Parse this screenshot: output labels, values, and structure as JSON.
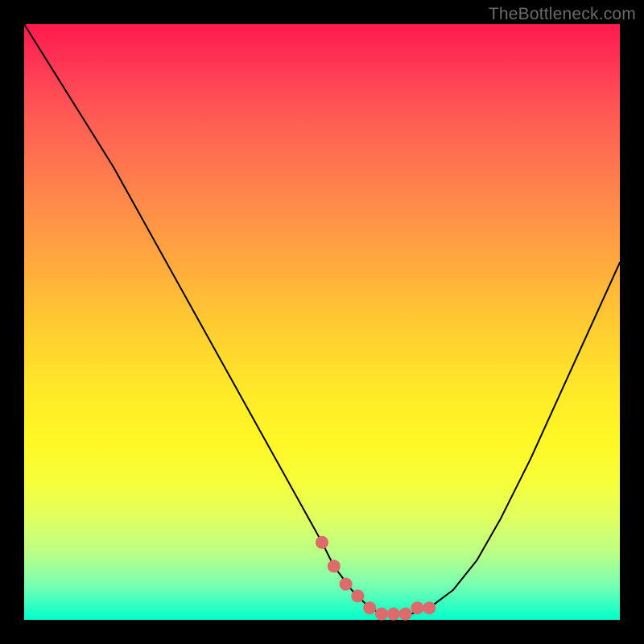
{
  "watermark": "TheBottleneck.com",
  "chart_data": {
    "type": "line",
    "title": "",
    "xlabel": "",
    "ylabel": "",
    "xlim": [
      0,
      100
    ],
    "ylim": [
      0,
      100
    ],
    "series": [
      {
        "name": "curve",
        "x": [
          0,
          5,
          10,
          15,
          20,
          25,
          30,
          35,
          40,
          45,
          50,
          52,
          55,
          58,
          60,
          62,
          65,
          68,
          72,
          76,
          80,
          85,
          90,
          95,
          100
        ],
        "values": [
          100,
          92,
          84,
          76,
          67,
          58,
          49,
          40,
          31,
          22,
          13,
          9,
          5,
          2,
          1,
          1,
          1,
          2,
          5,
          10,
          17,
          27,
          38,
          49,
          60
        ]
      },
      {
        "name": "highlight-dots",
        "x": [
          50,
          52,
          54,
          56,
          58,
          60,
          62,
          64,
          66,
          68
        ],
        "values": [
          13,
          9,
          6,
          4,
          2,
          1,
          1,
          1,
          2,
          2
        ]
      }
    ],
    "colors": {
      "curve": "#000000",
      "highlight": "#dd6b6b"
    }
  }
}
